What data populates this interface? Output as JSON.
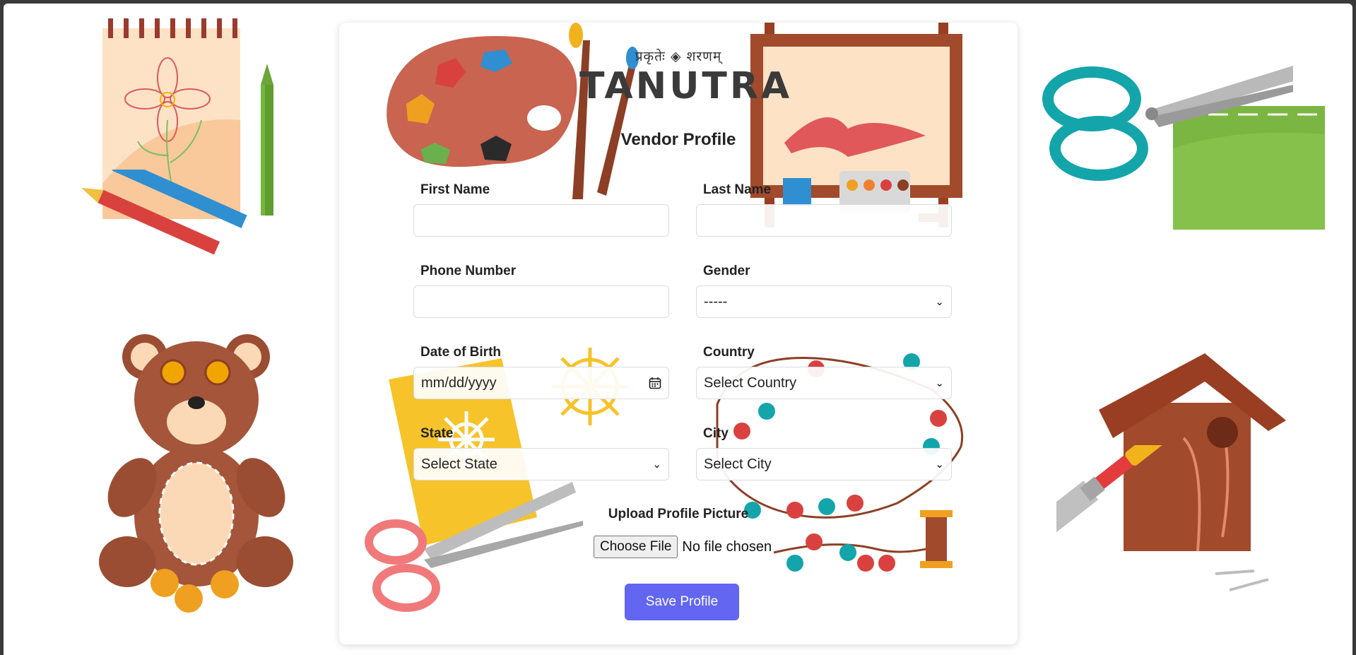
{
  "brand": {
    "tagline": "प्रकृतेः ◈ शरणम्",
    "name": "TANUTRA"
  },
  "form": {
    "title": "Vendor Profile",
    "fields": {
      "first_name": {
        "label": "First Name",
        "value": ""
      },
      "last_name": {
        "label": "Last Name",
        "value": ""
      },
      "phone": {
        "label": "Phone Number",
        "value": ""
      },
      "gender": {
        "label": "Gender",
        "selected": "-----"
      },
      "dob": {
        "label": "Date of Birth",
        "placeholder": "mm/dd/yyyy"
      },
      "country": {
        "label": "Country",
        "selected": "Select Country"
      },
      "state": {
        "label": "State",
        "selected": "Select State"
      },
      "city": {
        "label": "City",
        "selected": "Select City"
      }
    },
    "upload": {
      "label": "Upload Profile Picture",
      "button": "Choose File",
      "status": "No file chosen"
    },
    "save_label": "Save Profile"
  },
  "colors": {
    "primary": "#6366f1",
    "page_background": "#ffffff",
    "card_background": "#ffffff"
  },
  "icons": {
    "date_picker": "calendar-icon",
    "select": "chevron-down-icon"
  },
  "decorations": [
    "sketchpad-icon",
    "pencil-icon",
    "scissors-icon",
    "paper-icon",
    "teddy-bear-icon",
    "buttons-icon",
    "birdhouse-icon",
    "hammer-icon",
    "nails-icon",
    "palette-icon",
    "paintbrush-icon",
    "easel-icon",
    "paint-box-icon",
    "snowflake-paper-icon",
    "beads-icon",
    "thread-spool-icon"
  ]
}
